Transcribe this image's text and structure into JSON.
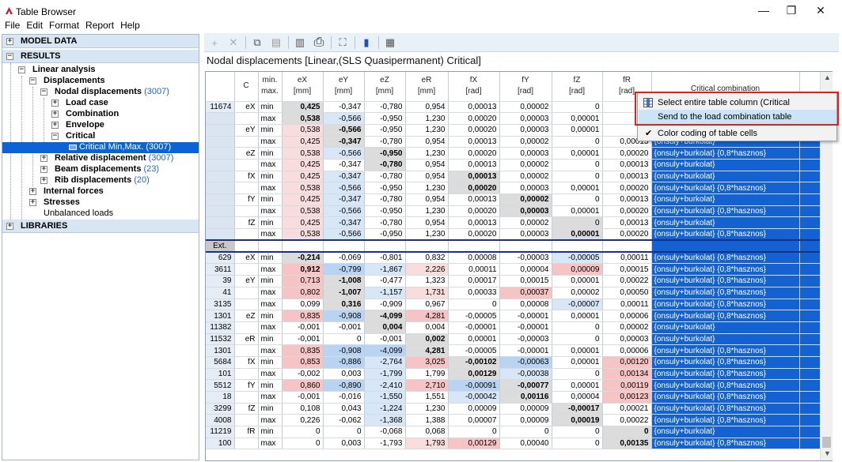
{
  "window": {
    "title": "Table Browser",
    "minimize": "—",
    "maximize": "❐",
    "close": "✕"
  },
  "menu": [
    "File",
    "Edit",
    "Format",
    "Report",
    "Help"
  ],
  "tree": {
    "model_data": "MODEL DATA",
    "results": "RESULTS",
    "linear_analysis": "Linear analysis",
    "displacements": "Displacements",
    "nodal_displacements": "Nodal displacements",
    "nodal_count": "(3007)",
    "load_case": "Load case",
    "combination": "Combination",
    "envelope": "Envelope",
    "critical": "Critical",
    "critical_minmax": "Critical Min,Max.",
    "critical_count": "(3007)",
    "relative_displacement": "Relative displacement",
    "relative_count": "(3007)",
    "beam_displacements": "Beam displacements",
    "beam_count": "(23)",
    "rib_displacements": "Rib displacements",
    "rib_count": "(20)",
    "internal_forces": "Internal forces",
    "stresses": "Stresses",
    "unbalanced_loads": "Unbalanced loads",
    "libraries": "LIBRARIES",
    "expand_plus": "+",
    "expand_minus": "−"
  },
  "toolbar": {
    "add": "+",
    "delete": "✕",
    "copy": "⧉",
    "paste": "▤",
    "columns": "▥",
    "print": "⎙",
    "fit": "⛶",
    "chart": "▮",
    "settings": "▦"
  },
  "table_title": "Nodal displacements [Linear,(SLS Quasipermanent) Critical]",
  "columns": {
    "c": "C",
    "minmax_1": "min.",
    "minmax_2": "max.",
    "ex_1": "eX",
    "ex_2": "[mm]",
    "ey_1": "eY",
    "ey_2": "[mm]",
    "ez_1": "eZ",
    "ez_2": "[mm]",
    "er_1": "eR",
    "er_2": "[mm]",
    "fx_1": "fX",
    "fx_2": "[rad]",
    "fy_1": "fY",
    "fy_2": "[rad]",
    "fz_1": "fZ",
    "fz_2": "[rad]",
    "fr_1": "fR",
    "fr_2": "[rad]",
    "crit": "Critical combination"
  },
  "ext_label": "Ext.",
  "rows": [
    {
      "id": "11674",
      "c": "eX",
      "m": "min",
      "v": [
        "0,425",
        "-0,347",
        "-0,780",
        "0,954",
        "0,00013",
        "0,00002",
        "0",
        "0,0"
      ],
      "crit": ""
    },
    {
      "id": "",
      "c": "",
      "m": "max",
      "v": [
        "0,538",
        "-0,566",
        "-0,950",
        "1,230",
        "0,00020",
        "0,00003",
        "0,00001",
        "0,0"
      ],
      "crit": ""
    },
    {
      "id": "",
      "c": "eY",
      "m": "min",
      "v": [
        "0,538",
        "-0,566",
        "-0,950",
        "1,230",
        "0,00020",
        "0,00003",
        "0,00001",
        "0,"
      ],
      "crit": ""
    },
    {
      "id": "",
      "c": "",
      "m": "max",
      "v": [
        "0,425",
        "-0,347",
        "-0,780",
        "0,954",
        "0,00013",
        "0,00002",
        "0",
        "0,00013"
      ],
      "crit": "{onsuly+burkolat}"
    },
    {
      "id": "",
      "c": "eZ",
      "m": "min",
      "v": [
        "0,538",
        "-0,566",
        "-0,950",
        "1,230",
        "0,00020",
        "0,00003",
        "0,00001",
        "0,00020"
      ],
      "crit": "{onsuly+burkolat} {0,8*hasznos}"
    },
    {
      "id": "",
      "c": "",
      "m": "max",
      "v": [
        "0,425",
        "-0,347",
        "-0,780",
        "0,954",
        "0,00013",
        "0,00002",
        "0",
        "0,00013"
      ],
      "crit": "{onsuly+burkolat}"
    },
    {
      "id": "",
      "c": "fX",
      "m": "min",
      "v": [
        "0,425",
        "-0,347",
        "-0,780",
        "0,954",
        "0,00013",
        "0,00002",
        "0",
        "0,00013"
      ],
      "crit": "{onsuly+burkolat}"
    },
    {
      "id": "",
      "c": "",
      "m": "max",
      "v": [
        "0,538",
        "-0,566",
        "-0,950",
        "1,230",
        "0,00020",
        "0,00003",
        "0,00001",
        "0,00020"
      ],
      "crit": "{onsuly+burkolat} {0,8*hasznos}"
    },
    {
      "id": "",
      "c": "fY",
      "m": "min",
      "v": [
        "0,425",
        "-0,347",
        "-0,780",
        "0,954",
        "0,00013",
        "0,00002",
        "0",
        "0,00013"
      ],
      "crit": "{onsuly+burkolat}"
    },
    {
      "id": "",
      "c": "",
      "m": "max",
      "v": [
        "0,538",
        "-0,566",
        "-0,950",
        "1,230",
        "0,00020",
        "0,00003",
        "0,00001",
        "0,00020"
      ],
      "crit": "{onsuly+burkolat} {0,8*hasznos}"
    },
    {
      "id": "",
      "c": "fZ",
      "m": "min",
      "v": [
        "0,425",
        "-0,347",
        "-0,780",
        "0,954",
        "0,00013",
        "0,00002",
        "0",
        "0,00013"
      ],
      "crit": "{onsuly+burkolat}"
    },
    {
      "id": "",
      "c": "",
      "m": "max",
      "v": [
        "0,538",
        "-0,566",
        "-0,950",
        "1,230",
        "0,00020",
        "0,00003",
        "0,00001",
        "0,00020"
      ],
      "crit": "{onsuly+burkolat} {0,8*hasznos}"
    }
  ],
  "ext_rows": [
    {
      "id": "629",
      "c": "eX",
      "m": "min",
      "v": [
        "-0,214",
        "-0,069",
        "-0,801",
        "0,832",
        "0,00008",
        "-0,00003",
        "-0,00005",
        "0,00011"
      ],
      "crit": "{onsuly+burkolat} {0,8*hasznos}"
    },
    {
      "id": "3611",
      "c": "",
      "m": "max",
      "v": [
        "0,912",
        "-0,799",
        "-1,867",
        "2,226",
        "0,00011",
        "0,00004",
        "0,00009",
        "0,00015"
      ],
      "crit": "{onsuly+burkolat} {0,8*hasznos}"
    },
    {
      "id": "39",
      "c": "eY",
      "m": "min",
      "v": [
        "0,713",
        "-1,008",
        "-0,477",
        "1,323",
        "0,00017",
        "0,00015",
        "0,00001",
        "0,00022"
      ],
      "crit": "{onsuly+burkolat} {0,8*hasznos}"
    },
    {
      "id": "41",
      "c": "",
      "m": "max",
      "v": [
        "0,802",
        "-1,007",
        "-1,157",
        "1,731",
        "0,00033",
        "0,00037",
        "0,00002",
        "0,00050"
      ],
      "crit": "{onsuly+burkolat} {0,8*hasznos}"
    },
    {
      "id": "3135",
      "c": "",
      "m": "max",
      "v": [
        "0,099",
        "0,316",
        "-0,909",
        "0,967",
        "0",
        "0,00008",
        "-0,00007",
        "0,00011"
      ],
      "crit": "{onsuly+burkolat} {0,8*hasznos}"
    },
    {
      "id": "1301",
      "c": "eZ",
      "m": "min",
      "v": [
        "0,835",
        "-0,908",
        "-4,099",
        "4,281",
        "-0,00005",
        "-0,00001",
        "0,00001",
        "0,00006"
      ],
      "crit": "{onsuly+burkolat} {0,8*hasznos}"
    },
    {
      "id": "11382",
      "c": "",
      "m": "max",
      "v": [
        "-0,001",
        "-0,001",
        "0,004",
        "0,004",
        "-0,00001",
        "-0,00001",
        "0",
        "0,00002"
      ],
      "crit": "{onsuly+burkolat}"
    },
    {
      "id": "11532",
      "c": "eR",
      "m": "min",
      "v": [
        "-0,001",
        "0",
        "-0,001",
        "0,002",
        "0,00001",
        "-0,00003",
        "0",
        "0,00003"
      ],
      "crit": "{onsuly+burkolat}"
    },
    {
      "id": "1301",
      "c": "",
      "m": "max",
      "v": [
        "0,835",
        "-0,908",
        "-4,099",
        "4,281",
        "-0,00005",
        "-0,00001",
        "0,00001",
        "0,00006"
      ],
      "crit": "{onsuly+burkolat} {0,8*hasznos}"
    },
    {
      "id": "5684",
      "c": "fX",
      "m": "min",
      "v": [
        "0,853",
        "-0,886",
        "-2,764",
        "3,025",
        "-0,00102",
        "-0,00063",
        "0,00001",
        "0,00120"
      ],
      "crit": "{onsuly+burkolat} {0,8*hasznos}"
    },
    {
      "id": "101",
      "c": "",
      "m": "max",
      "v": [
        "-0,002",
        "0,003",
        "-1,799",
        "1,799",
        "0,00129",
        "-0,00038",
        "0",
        "0,00134"
      ],
      "crit": "{onsuly+burkolat} {0,8*hasznos}"
    },
    {
      "id": "5512",
      "c": "fY",
      "m": "min",
      "v": [
        "0,860",
        "-0,890",
        "-2,410",
        "2,710",
        "-0,00091",
        "-0,00077",
        "0,00001",
        "0,00119"
      ],
      "crit": "{onsuly+burkolat} {0,8*hasznos}"
    },
    {
      "id": "18",
      "c": "",
      "m": "max",
      "v": [
        "-0,001",
        "-0,016",
        "-1,550",
        "1,551",
        "-0,00042",
        "0,00116",
        "0,00004",
        "0,00123"
      ],
      "crit": "{onsuly+burkolat} {0,8*hasznos}"
    },
    {
      "id": "3299",
      "c": "fZ",
      "m": "min",
      "v": [
        "0,108",
        "0,043",
        "-1,224",
        "1,230",
        "0,00009",
        "0,00009",
        "-0,00017",
        "0,00021"
      ],
      "crit": "{onsuly+burkolat} {0,8*hasznos}"
    },
    {
      "id": "4008",
      "c": "",
      "m": "max",
      "v": [
        "0,226",
        "-0,062",
        "-1,368",
        "1,388",
        "0,00007",
        "0,00009",
        "0,00019",
        "0,00022"
      ],
      "crit": "{onsuly+burkolat} {0,8*hasznos}"
    },
    {
      "id": "11219",
      "c": "fR",
      "m": "min",
      "v": [
        "0",
        "0",
        "-0,068",
        "0,068",
        "0",
        "0",
        "0",
        "0"
      ],
      "crit": "{onsuly+burkolat}"
    },
    {
      "id": "100",
      "c": "",
      "m": "max",
      "v": [
        "0",
        "0,003",
        "-1,793",
        "1,793",
        "0,00129",
        "0,00040",
        "0",
        "0,00135"
      ],
      "crit": "{onsuly+burkolat} {0,8*hasznos}"
    }
  ],
  "context_menu": {
    "select_column": "Select entire table column (Critical combination)",
    "send_to_load": "Send to the load combination table",
    "color_coding": "Color coding of table cells",
    "check": "✔"
  },
  "scroll": {
    "up": "▲",
    "down": "▼"
  }
}
